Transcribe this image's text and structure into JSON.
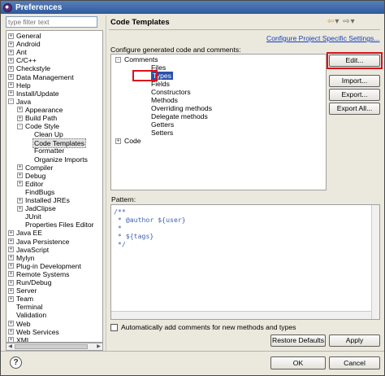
{
  "window": {
    "title": "Preferences"
  },
  "filter": {
    "placeholder": "type filter text"
  },
  "nav_tree": [
    {
      "label": "General",
      "level": 0,
      "expand": "+"
    },
    {
      "label": "Android",
      "level": 0,
      "expand": "+"
    },
    {
      "label": "Ant",
      "level": 0,
      "expand": "+"
    },
    {
      "label": "C/C++",
      "level": 0,
      "expand": "+"
    },
    {
      "label": "Checkstyle",
      "level": 0,
      "expand": "+"
    },
    {
      "label": "Data Management",
      "level": 0,
      "expand": "+"
    },
    {
      "label": "Help",
      "level": 0,
      "expand": "+"
    },
    {
      "label": "Install/Update",
      "level": 0,
      "expand": "+"
    },
    {
      "label": "Java",
      "level": 0,
      "expand": "-"
    },
    {
      "label": "Appearance",
      "level": 1,
      "expand": "+"
    },
    {
      "label": "Build Path",
      "level": 1,
      "expand": "+"
    },
    {
      "label": "Code Style",
      "level": 1,
      "expand": "-"
    },
    {
      "label": "Clean Up",
      "level": 2,
      "expand": ""
    },
    {
      "label": "Code Templates",
      "level": 2,
      "expand": "",
      "selected": true
    },
    {
      "label": "Formatter",
      "level": 2,
      "expand": ""
    },
    {
      "label": "Organize Imports",
      "level": 2,
      "expand": ""
    },
    {
      "label": "Compiler",
      "level": 1,
      "expand": "+"
    },
    {
      "label": "Debug",
      "level": 1,
      "expand": "+"
    },
    {
      "label": "Editor",
      "level": 1,
      "expand": "+"
    },
    {
      "label": "FindBugs",
      "level": 1,
      "expand": ""
    },
    {
      "label": "Installed JREs",
      "level": 1,
      "expand": "+"
    },
    {
      "label": "JadClipse",
      "level": 1,
      "expand": "+"
    },
    {
      "label": "JUnit",
      "level": 1,
      "expand": ""
    },
    {
      "label": "Properties Files Editor",
      "level": 1,
      "expand": ""
    },
    {
      "label": "Java EE",
      "level": 0,
      "expand": "+"
    },
    {
      "label": "Java Persistence",
      "level": 0,
      "expand": "+"
    },
    {
      "label": "JavaScript",
      "level": 0,
      "expand": "+"
    },
    {
      "label": "Mylyn",
      "level": 0,
      "expand": "+"
    },
    {
      "label": "Plug-in Development",
      "level": 0,
      "expand": "+"
    },
    {
      "label": "Remote Systems",
      "level": 0,
      "expand": "+"
    },
    {
      "label": "Run/Debug",
      "level": 0,
      "expand": "+"
    },
    {
      "label": "Server",
      "level": 0,
      "expand": "+"
    },
    {
      "label": "Team",
      "level": 0,
      "expand": "+"
    },
    {
      "label": "Terminal",
      "level": 0,
      "expand": ""
    },
    {
      "label": "Validation",
      "level": 0,
      "expand": ""
    },
    {
      "label": "Web",
      "level": 0,
      "expand": "+"
    },
    {
      "label": "Web Services",
      "level": 0,
      "expand": "+"
    },
    {
      "label": "XML",
      "level": 0,
      "expand": "+"
    }
  ],
  "page": {
    "title": "Code Templates",
    "config_link": "Configure Project Specific Settings...",
    "description": "Configure generated code and comments:",
    "pattern_label": "Pattern:",
    "auto_comments_label": "Automatically add comments for new methods and types",
    "auto_comments_checked": false
  },
  "template_tree": [
    {
      "label": "Comments",
      "level": 0,
      "expand": "-"
    },
    {
      "label": "Files",
      "level": 1
    },
    {
      "label": "Types",
      "level": 1,
      "selected": true
    },
    {
      "label": "Fields",
      "level": 1
    },
    {
      "label": "Constructors",
      "level": 1
    },
    {
      "label": "Methods",
      "level": 1
    },
    {
      "label": "Overriding methods",
      "level": 1
    },
    {
      "label": "Delegate methods",
      "level": 1
    },
    {
      "label": "Getters",
      "level": 1
    },
    {
      "label": "Setters",
      "level": 1
    },
    {
      "label": "Code",
      "level": 0,
      "expand": "+"
    }
  ],
  "pattern_lines": [
    "/**",
    " * @author ${user}",
    " *",
    " * ${tags}",
    " */"
  ],
  "buttons": {
    "edit": "Edit...",
    "import": "Import...",
    "export": "Export...",
    "export_all": "Export All...",
    "restore_defaults": "Restore Defaults",
    "apply": "Apply",
    "ok": "OK",
    "cancel": "Cancel"
  },
  "icons": {
    "help": "?",
    "back": "⇦",
    "forward": "⇨"
  },
  "colors": {
    "selection": "#2b50a8",
    "highlight_box": "#d9131b",
    "link": "#1a3fb8",
    "code": "#3f62b4"
  }
}
